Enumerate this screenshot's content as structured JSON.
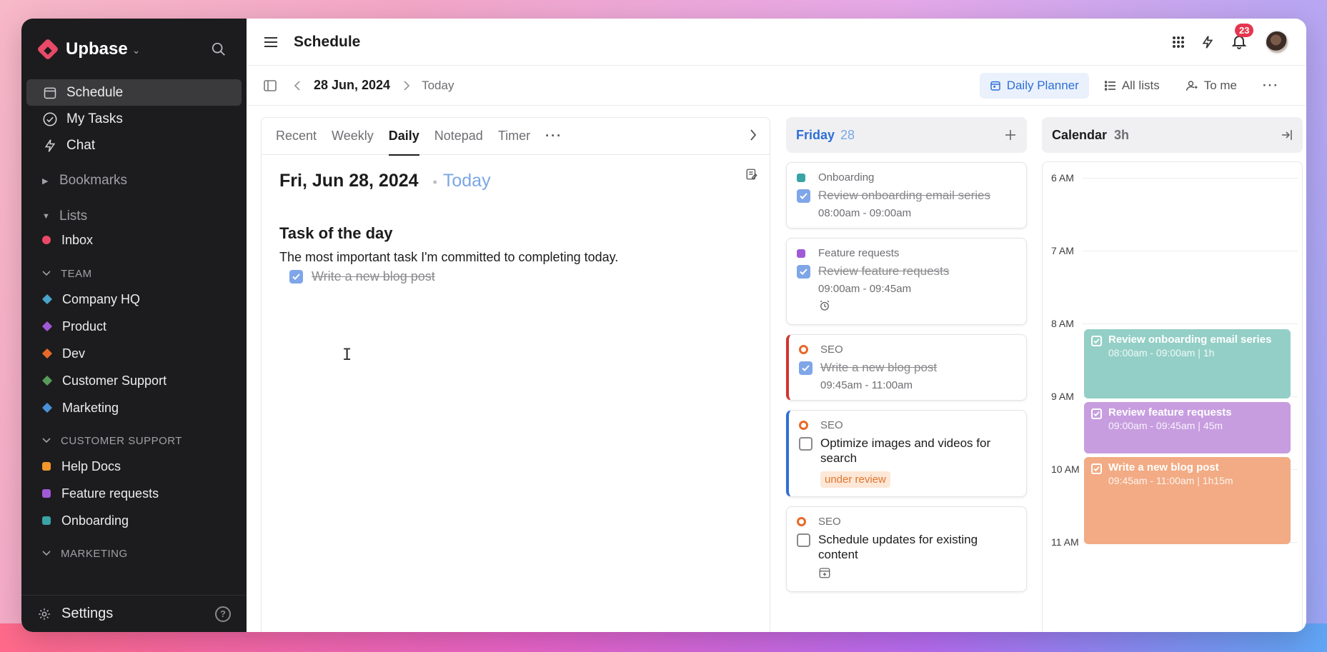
{
  "app": {
    "name": "Upbase"
  },
  "sidebar": {
    "nav": [
      {
        "label": "Schedule",
        "icon": "calendar-icon",
        "active": true
      },
      {
        "label": "My Tasks",
        "icon": "check-circle-icon"
      },
      {
        "label": "Chat",
        "icon": "bolt-icon"
      }
    ],
    "bookmarks_label": "Bookmarks",
    "lists_label": "Lists",
    "inbox_label": "Inbox",
    "team": {
      "label": "TEAM",
      "items": [
        {
          "label": "Company HQ",
          "color": "#4aa3c8"
        },
        {
          "label": "Product",
          "color": "#a05ad6"
        },
        {
          "label": "Dev",
          "color": "#e8682a"
        },
        {
          "label": "Customer Support",
          "color": "#5a9a5a"
        },
        {
          "label": "Marketing",
          "color": "#4a90d9"
        }
      ]
    },
    "customer_support": {
      "label": "CUSTOMER SUPPORT",
      "items": [
        {
          "label": "Help Docs",
          "color": "#f0962a"
        },
        {
          "label": "Feature requests",
          "color": "#a05ad6"
        },
        {
          "label": "Onboarding",
          "color": "#3aa3a6"
        }
      ]
    },
    "marketing_label": "MARKETING",
    "settings_label": "Settings"
  },
  "topbar": {
    "title": "Schedule",
    "notification_count": "23"
  },
  "subbar": {
    "date": "28 Jun, 2024",
    "today": "Today",
    "views": [
      "Daily Planner",
      "All lists",
      "To me"
    ]
  },
  "daily": {
    "tabs": [
      "Recent",
      "Weekly",
      "Daily",
      "Notepad",
      "Timer"
    ],
    "active_tab": "Daily",
    "date": "Fri, Jun 28, 2024",
    "today": "Today",
    "task_of_day_heading": "Task of the day",
    "task_of_day_desc": "The most important task I'm committed to completing today.",
    "task_of_day": "Write a new blog post"
  },
  "friday": {
    "day": "Friday",
    "num": "28",
    "cards": [
      {
        "list": "Onboarding",
        "list_color": "#3aa3a6",
        "task": "Review onboarding email series",
        "time": "08:00am - 09:00am",
        "done": true
      },
      {
        "list": "Feature requests",
        "list_color": "#a05ad6",
        "task": "Review feature requests",
        "time": "09:00am - 09:45am",
        "done": true
      },
      {
        "list": "SEO",
        "task": "Write a new blog post",
        "time": "09:45am - 11:00am",
        "done": true
      },
      {
        "list": "SEO",
        "task": "Optimize images and videos for search",
        "tag": "under review",
        "done": false
      },
      {
        "list": "SEO",
        "task": "Schedule updates for existing content",
        "done": false
      }
    ]
  },
  "calendar": {
    "title": "Calendar",
    "hours_total": "3h",
    "hour_labels": [
      "6 AM",
      "7 AM",
      "8 AM",
      "9 AM",
      "10 AM",
      "11 AM"
    ],
    "events": [
      {
        "title": "Review onboarding email series",
        "sub": "08:00am - 09:00am | 1h",
        "color": "#93cfc6",
        "start_hour": 8.0,
        "end_hour": 9.0
      },
      {
        "title": "Review feature requests",
        "sub": "09:00am - 09:45am | 45m",
        "color": "#c79ddf",
        "start_hour": 9.0,
        "end_hour": 9.75
      },
      {
        "title": "Write a new blog post",
        "sub": "09:45am - 11:00am | 1h15m",
        "color": "#f2ab84",
        "start_hour": 9.75,
        "end_hour": 11.0
      }
    ]
  }
}
